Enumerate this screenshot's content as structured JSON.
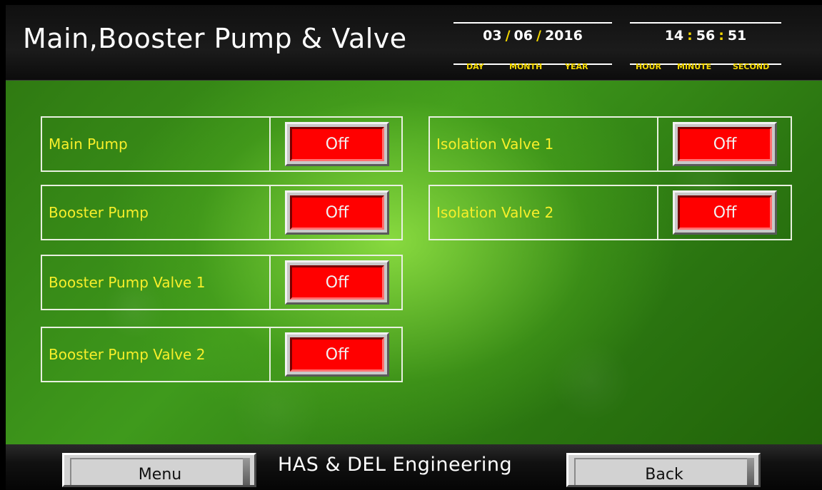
{
  "header": {
    "title": "Main,Booster Pump & Valve",
    "date": {
      "day": "03",
      "month": "06",
      "year": "2016",
      "sep": "/",
      "day_label": "DAY",
      "month_label": "MONTH",
      "year_label": "YEAR"
    },
    "time": {
      "hour": "14",
      "minute": "56",
      "second": "51",
      "sep": ":",
      "hour_label": "HOUR",
      "minute_label": "MINUTE",
      "second_label": "SECOND"
    }
  },
  "controls_left": [
    {
      "label": "Main Pump",
      "state": "Off"
    },
    {
      "label": "Booster Pump",
      "state": "Off"
    },
    {
      "label": "Booster Pump Valve 1",
      "state": "Off"
    },
    {
      "label": "Booster Pump Valve 2",
      "state": "Off"
    }
  ],
  "controls_right": [
    {
      "label": "Isolation Valve 1",
      "state": "Off"
    },
    {
      "label": "Isolation Valve 2",
      "state": "Off"
    }
  ],
  "footer": {
    "menu_label": "Menu",
    "brand": "HAS & DEL Engineering",
    "back_label": "Back"
  },
  "colors": {
    "label_text": "#f7ef2a",
    "off_button": "#ff0000",
    "accent_yellow": "#f5d800"
  }
}
